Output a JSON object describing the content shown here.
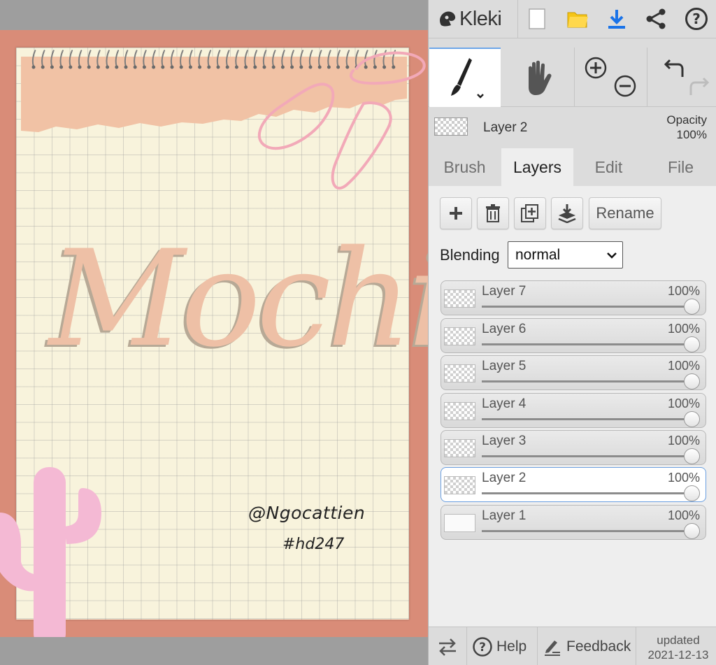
{
  "app": {
    "name": "Kleki",
    "brand_color": "#333333",
    "accent_color": "#1a73e8"
  },
  "toolbar": {
    "icons": [
      "new-image-icon",
      "open-folder-icon",
      "download-icon",
      "share-icon",
      "help-icon"
    ]
  },
  "tools": {
    "brush": "brush-icon",
    "hand": "hand-icon",
    "zoom_in": "zoom-in-icon",
    "zoom_out": "zoom-out-icon",
    "undo": "undo-icon",
    "redo": "redo-icon"
  },
  "current_layer": {
    "name": "Layer 2",
    "opacity_label": "Opacity",
    "opacity_value": "100%"
  },
  "tabs": [
    {
      "label": "Brush",
      "active": false
    },
    {
      "label": "Layers",
      "active": true
    },
    {
      "label": "Edit",
      "active": false
    },
    {
      "label": "File",
      "active": false
    }
  ],
  "layer_actions": {
    "add": "plus-icon",
    "delete": "trash-icon",
    "duplicate": "duplicate-icon",
    "merge": "merge-down-icon",
    "rename_label": "Rename"
  },
  "blending": {
    "label": "Blending",
    "value": "normal"
  },
  "layers": [
    {
      "name": "Layer 7",
      "opacity": "100%",
      "opacity_fraction": 1.0,
      "active": false
    },
    {
      "name": "Layer 6",
      "opacity": "100%",
      "opacity_fraction": 1.0,
      "active": false
    },
    {
      "name": "Layer 5",
      "opacity": "100%",
      "opacity_fraction": 1.0,
      "active": false
    },
    {
      "name": "Layer 4",
      "opacity": "100%",
      "opacity_fraction": 1.0,
      "active": false
    },
    {
      "name": "Layer 3",
      "opacity": "100%",
      "opacity_fraction": 1.0,
      "active": false
    },
    {
      "name": "Layer 2",
      "opacity": "100%",
      "opacity_fraction": 1.0,
      "active": true
    },
    {
      "name": "Layer 1",
      "opacity": "100%",
      "opacity_fraction": 1.0,
      "active": false
    }
  ],
  "footer": {
    "help_label": "Help",
    "feedback_label": "Feedback",
    "updated_label": "updated",
    "updated_date": "2021-12-13"
  },
  "artwork": {
    "title_text": "Mochi",
    "handle_text": "@Ngocattien",
    "hashtag_text": "#hd247",
    "frame_color": "#d98c78",
    "paper_color": "#f8f3dc",
    "torn_paper_color": "#f1c2a5",
    "clip_color": "#f2a9b8",
    "cactus_color": "#f4b9d4"
  }
}
